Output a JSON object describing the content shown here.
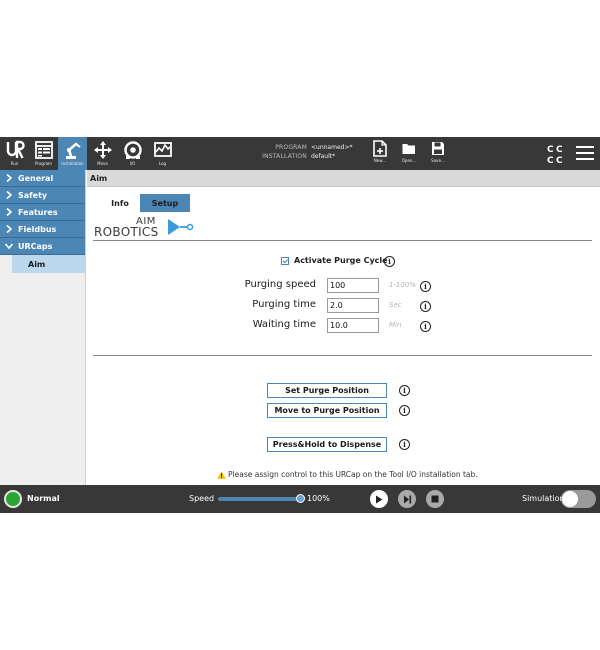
{
  "nav": {
    "buttons": [
      {
        "id": "run",
        "label": "Run",
        "icon": "ur-logo-icon"
      },
      {
        "id": "program",
        "label": "Program",
        "icon": "program-icon"
      },
      {
        "id": "installation",
        "label": "Installation",
        "icon": "robot-arm-icon",
        "active": true
      },
      {
        "id": "move",
        "label": "Move",
        "icon": "move-arrows-icon"
      },
      {
        "id": "io",
        "label": "I/O",
        "icon": "io-icon"
      },
      {
        "id": "log",
        "label": "Log",
        "icon": "log-icon"
      }
    ]
  },
  "program_info": {
    "program_label": "PROGRAM",
    "program_value": "<unnamed>*",
    "installation_label": "INSTALLATION",
    "installation_value": "default*"
  },
  "file_buttons": {
    "new_label": "New...",
    "open_label": "Open...",
    "save_label": "Save..."
  },
  "sidebar": {
    "items": [
      {
        "label": "General"
      },
      {
        "label": "Safety"
      },
      {
        "label": "Features"
      },
      {
        "label": "Fieldbus"
      },
      {
        "label": "URCaps",
        "expanded": true
      }
    ],
    "sub_item": "Aim"
  },
  "main": {
    "header": "Aim",
    "tabs": [
      {
        "label": "Info"
      },
      {
        "label": "Setup",
        "active": true
      }
    ],
    "logo": {
      "line1": "AIM",
      "line2": "ROBOTICS"
    },
    "activate_purge_label": "Activate Purge Cycle",
    "activate_purge_checked": true,
    "fields": [
      {
        "label": "Purging speed",
        "value": "100",
        "unit": "1-100%"
      },
      {
        "label": "Purging time",
        "value": "2.0",
        "unit": "Sec"
      },
      {
        "label": "Waiting time",
        "value": "10.0",
        "unit": "Min"
      }
    ],
    "buttons": {
      "set_purge": "Set Purge Position",
      "move_purge": "Move to Purge Position",
      "press_hold": "Press&Hold to Dispense"
    },
    "warning": "Please assign control to this URCap on the Tool I/O installation tab.",
    "info_glyph": "i"
  },
  "bottom": {
    "status": "Normal",
    "status_color": "#2aa531",
    "speed_label": "Speed",
    "speed_value": "100%",
    "speed_fraction": 1.0,
    "simulation_label": "Simulation",
    "simulation_on": false
  },
  "colors": {
    "accent": "#4b86b4",
    "bar": "#383838"
  }
}
